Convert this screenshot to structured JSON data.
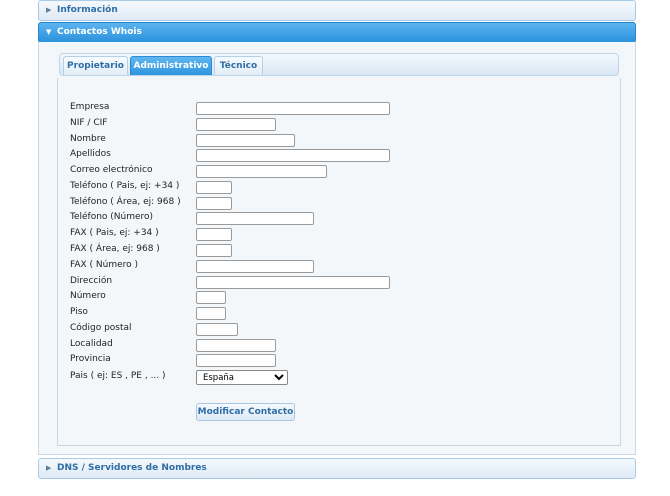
{
  "accordion": {
    "info_title": "Información",
    "contacts_title": "Contactos Whois",
    "dns_title": "DNS / Servidores de Nombres"
  },
  "tabs": [
    {
      "label": "Propietario",
      "active": false
    },
    {
      "label": "Administrativo",
      "active": true
    },
    {
      "label": "Técnico",
      "active": false
    }
  ],
  "form": {
    "fields": [
      {
        "label": "Empresa",
        "value": ""
      },
      {
        "label": "NIF / CIF",
        "value": ""
      },
      {
        "label": "Nombre",
        "value": ""
      },
      {
        "label": "Apellidos",
        "value": ""
      },
      {
        "label": "Correo electrónico",
        "value": ""
      },
      {
        "label": "Teléfono ( Pais, ej: +34 )",
        "value": ""
      },
      {
        "label": "Teléfono ( Área, ej: 968 )",
        "value": ""
      },
      {
        "label": "Teléfono (Número)",
        "value": ""
      },
      {
        "label": "FAX ( Pais, ej: +34 )",
        "value": ""
      },
      {
        "label": "FAX ( Área, ej: 968 )",
        "value": ""
      },
      {
        "label": "FAX ( Número )",
        "value": ""
      },
      {
        "label": "Dirección",
        "value": ""
      },
      {
        "label": "Número",
        "value": ""
      },
      {
        "label": "Piso",
        "value": ""
      },
      {
        "label": "Código postal",
        "value": ""
      },
      {
        "label": "Localidad",
        "value": ""
      },
      {
        "label": "Provincia",
        "value": ""
      }
    ],
    "country": {
      "label": "Pais ( ej: ES , PE , ... )",
      "selected": "España"
    },
    "submit_label": "Modificar Contacto"
  }
}
